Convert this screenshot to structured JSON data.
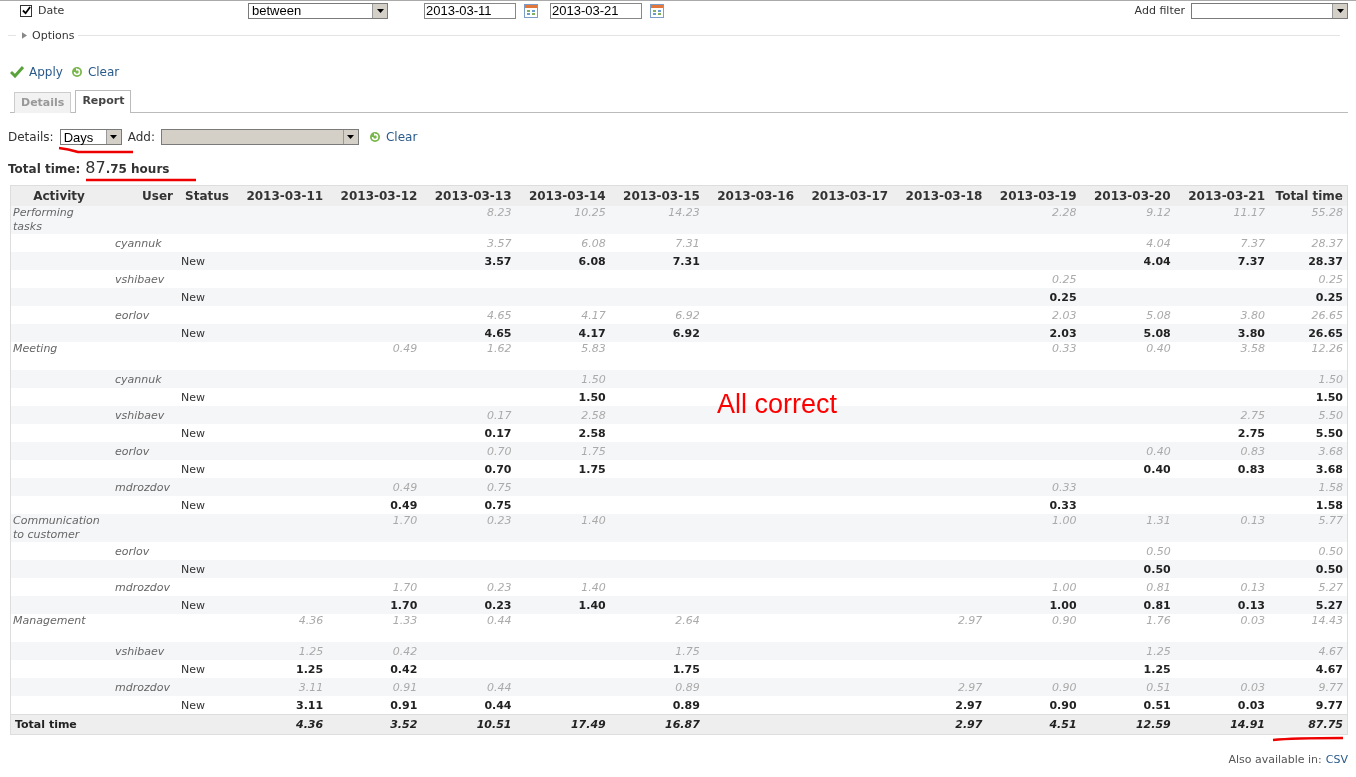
{
  "filter": {
    "checked": true,
    "label": "Date",
    "operator": "between",
    "from": "2013-03-11",
    "to": "2013-03-21",
    "add_filter_label": "Add filter"
  },
  "options": {
    "label": "Options",
    "expanded": false
  },
  "actions": {
    "apply": "Apply",
    "clear": "Clear"
  },
  "tabs": [
    {
      "label": "Details",
      "selected": false
    },
    {
      "label": "Report",
      "selected": true
    }
  ],
  "report_controls": {
    "details_label": "Details:",
    "details_value": "Days",
    "add_label": "Add:",
    "clear": "Clear"
  },
  "total": {
    "label": "Total time:",
    "hours_major": "87",
    "hours_minor": ".75 hours"
  },
  "table": {
    "columns": [
      "Activity",
      "User",
      "Status",
      "2013-03-11",
      "2013-03-12",
      "2013-03-13",
      "2013-03-14",
      "2013-03-15",
      "2013-03-16",
      "2013-03-17",
      "2013-03-18",
      "2013-03-19",
      "2013-03-20",
      "2013-03-21",
      "Total time"
    ],
    "rows": [
      {
        "kind": "activity",
        "cells": [
          {
            "kind": "label",
            "value": "Performing tasks"
          },
          {
            "kind": "empty"
          },
          {
            "kind": "empty"
          },
          {
            "kind": "empty"
          },
          {
            "kind": "empty"
          },
          {
            "kind": "hours",
            "value": "8.23"
          },
          {
            "kind": "hours",
            "value": "10.25"
          },
          {
            "kind": "hours",
            "value": "14.23"
          },
          {
            "kind": "empty"
          },
          {
            "kind": "empty"
          },
          {
            "kind": "empty"
          },
          {
            "kind": "hours",
            "value": "2.28"
          },
          {
            "kind": "hours",
            "value": "9.12"
          },
          {
            "kind": "hours",
            "value": "11.17"
          },
          {
            "kind": "total",
            "value": "55.28"
          }
        ]
      },
      {
        "kind": "user",
        "cells": [
          {
            "kind": "empty"
          },
          {
            "kind": "label",
            "value": "cyannuk"
          },
          {
            "kind": "empty"
          },
          {
            "kind": "empty"
          },
          {
            "kind": "empty"
          },
          {
            "kind": "hours",
            "value": "3.57"
          },
          {
            "kind": "hours",
            "value": "6.08"
          },
          {
            "kind": "hours",
            "value": "7.31"
          },
          {
            "kind": "empty"
          },
          {
            "kind": "empty"
          },
          {
            "kind": "empty"
          },
          {
            "kind": "empty"
          },
          {
            "kind": "hours",
            "value": "4.04"
          },
          {
            "kind": "hours",
            "value": "7.37"
          },
          {
            "kind": "total",
            "value": "28.37"
          }
        ]
      },
      {
        "kind": "status",
        "cells": [
          {
            "kind": "empty"
          },
          {
            "kind": "empty"
          },
          {
            "kind": "label",
            "value": "New"
          },
          {
            "kind": "empty"
          },
          {
            "kind": "empty"
          },
          {
            "kind": "hours",
            "value": "3.57"
          },
          {
            "kind": "hours",
            "value": "6.08"
          },
          {
            "kind": "hours",
            "value": "7.31"
          },
          {
            "kind": "empty"
          },
          {
            "kind": "empty"
          },
          {
            "kind": "empty"
          },
          {
            "kind": "empty"
          },
          {
            "kind": "hours",
            "value": "4.04"
          },
          {
            "kind": "hours",
            "value": "7.37"
          },
          {
            "kind": "total",
            "value": "28.37"
          }
        ]
      },
      {
        "kind": "user",
        "cells": [
          {
            "kind": "empty"
          },
          {
            "kind": "label",
            "value": "vshibaev"
          },
          {
            "kind": "empty"
          },
          {
            "kind": "empty"
          },
          {
            "kind": "empty"
          },
          {
            "kind": "empty"
          },
          {
            "kind": "empty"
          },
          {
            "kind": "empty"
          },
          {
            "kind": "empty"
          },
          {
            "kind": "empty"
          },
          {
            "kind": "empty"
          },
          {
            "kind": "hours",
            "value": "0.25"
          },
          {
            "kind": "empty"
          },
          {
            "kind": "empty"
          },
          {
            "kind": "total",
            "value": "0.25"
          }
        ]
      },
      {
        "kind": "status",
        "cells": [
          {
            "kind": "empty"
          },
          {
            "kind": "empty"
          },
          {
            "kind": "label",
            "value": "New"
          },
          {
            "kind": "empty"
          },
          {
            "kind": "empty"
          },
          {
            "kind": "empty"
          },
          {
            "kind": "empty"
          },
          {
            "kind": "empty"
          },
          {
            "kind": "empty"
          },
          {
            "kind": "empty"
          },
          {
            "kind": "empty"
          },
          {
            "kind": "hours",
            "value": "0.25"
          },
          {
            "kind": "empty"
          },
          {
            "kind": "empty"
          },
          {
            "kind": "total",
            "value": "0.25"
          }
        ]
      },
      {
        "kind": "user",
        "cells": [
          {
            "kind": "empty"
          },
          {
            "kind": "label",
            "value": "eorlov"
          },
          {
            "kind": "empty"
          },
          {
            "kind": "empty"
          },
          {
            "kind": "empty"
          },
          {
            "kind": "hours",
            "value": "4.65"
          },
          {
            "kind": "hours",
            "value": "4.17"
          },
          {
            "kind": "hours",
            "value": "6.92"
          },
          {
            "kind": "empty"
          },
          {
            "kind": "empty"
          },
          {
            "kind": "empty"
          },
          {
            "kind": "hours",
            "value": "2.03"
          },
          {
            "kind": "hours",
            "value": "5.08"
          },
          {
            "kind": "hours",
            "value": "3.80"
          },
          {
            "kind": "total",
            "value": "26.65"
          }
        ]
      },
      {
        "kind": "status",
        "cells": [
          {
            "kind": "empty"
          },
          {
            "kind": "empty"
          },
          {
            "kind": "label",
            "value": "New"
          },
          {
            "kind": "empty"
          },
          {
            "kind": "empty"
          },
          {
            "kind": "hours",
            "value": "4.65"
          },
          {
            "kind": "hours",
            "value": "4.17"
          },
          {
            "kind": "hours",
            "value": "6.92"
          },
          {
            "kind": "empty"
          },
          {
            "kind": "empty"
          },
          {
            "kind": "empty"
          },
          {
            "kind": "hours",
            "value": "2.03"
          },
          {
            "kind": "hours",
            "value": "5.08"
          },
          {
            "kind": "hours",
            "value": "3.80"
          },
          {
            "kind": "total",
            "value": "26.65"
          }
        ]
      },
      {
        "kind": "activity",
        "cells": [
          {
            "kind": "label",
            "value": "Meeting"
          },
          {
            "kind": "empty"
          },
          {
            "kind": "empty"
          },
          {
            "kind": "empty"
          },
          {
            "kind": "hours",
            "value": "0.49"
          },
          {
            "kind": "hours",
            "value": "1.62"
          },
          {
            "kind": "hours",
            "value": "5.83"
          },
          {
            "kind": "empty"
          },
          {
            "kind": "empty"
          },
          {
            "kind": "empty"
          },
          {
            "kind": "empty"
          },
          {
            "kind": "hours",
            "value": "0.33"
          },
          {
            "kind": "hours",
            "value": "0.40"
          },
          {
            "kind": "hours",
            "value": "3.58"
          },
          {
            "kind": "total",
            "value": "12.26"
          }
        ]
      },
      {
        "kind": "user",
        "cells": [
          {
            "kind": "empty"
          },
          {
            "kind": "label",
            "value": "cyannuk"
          },
          {
            "kind": "empty"
          },
          {
            "kind": "empty"
          },
          {
            "kind": "empty"
          },
          {
            "kind": "empty"
          },
          {
            "kind": "hours",
            "value": "1.50"
          },
          {
            "kind": "empty"
          },
          {
            "kind": "empty"
          },
          {
            "kind": "empty"
          },
          {
            "kind": "empty"
          },
          {
            "kind": "empty"
          },
          {
            "kind": "empty"
          },
          {
            "kind": "empty"
          },
          {
            "kind": "total",
            "value": "1.50"
          }
        ]
      },
      {
        "kind": "status",
        "cells": [
          {
            "kind": "empty"
          },
          {
            "kind": "empty"
          },
          {
            "kind": "label",
            "value": "New"
          },
          {
            "kind": "empty"
          },
          {
            "kind": "empty"
          },
          {
            "kind": "empty"
          },
          {
            "kind": "hours",
            "value": "1.50"
          },
          {
            "kind": "empty"
          },
          {
            "kind": "empty"
          },
          {
            "kind": "empty"
          },
          {
            "kind": "empty"
          },
          {
            "kind": "empty"
          },
          {
            "kind": "empty"
          },
          {
            "kind": "empty"
          },
          {
            "kind": "total",
            "value": "1.50"
          }
        ]
      },
      {
        "kind": "user",
        "cells": [
          {
            "kind": "empty"
          },
          {
            "kind": "label",
            "value": "vshibaev"
          },
          {
            "kind": "empty"
          },
          {
            "kind": "empty"
          },
          {
            "kind": "empty"
          },
          {
            "kind": "hours",
            "value": "0.17"
          },
          {
            "kind": "hours",
            "value": "2.58"
          },
          {
            "kind": "empty"
          },
          {
            "kind": "empty"
          },
          {
            "kind": "empty"
          },
          {
            "kind": "empty"
          },
          {
            "kind": "empty"
          },
          {
            "kind": "empty"
          },
          {
            "kind": "hours",
            "value": "2.75"
          },
          {
            "kind": "total",
            "value": "5.50"
          }
        ]
      },
      {
        "kind": "status",
        "cells": [
          {
            "kind": "empty"
          },
          {
            "kind": "empty"
          },
          {
            "kind": "label",
            "value": "New"
          },
          {
            "kind": "empty"
          },
          {
            "kind": "empty"
          },
          {
            "kind": "hours",
            "value": "0.17"
          },
          {
            "kind": "hours",
            "value": "2.58"
          },
          {
            "kind": "empty"
          },
          {
            "kind": "empty"
          },
          {
            "kind": "empty"
          },
          {
            "kind": "empty"
          },
          {
            "kind": "empty"
          },
          {
            "kind": "empty"
          },
          {
            "kind": "hours",
            "value": "2.75"
          },
          {
            "kind": "total",
            "value": "5.50"
          }
        ]
      },
      {
        "kind": "user",
        "cells": [
          {
            "kind": "empty"
          },
          {
            "kind": "label",
            "value": "eorlov"
          },
          {
            "kind": "empty"
          },
          {
            "kind": "empty"
          },
          {
            "kind": "empty"
          },
          {
            "kind": "hours",
            "value": "0.70"
          },
          {
            "kind": "hours",
            "value": "1.75"
          },
          {
            "kind": "empty"
          },
          {
            "kind": "empty"
          },
          {
            "kind": "empty"
          },
          {
            "kind": "empty"
          },
          {
            "kind": "empty"
          },
          {
            "kind": "hours",
            "value": "0.40"
          },
          {
            "kind": "hours",
            "value": "0.83"
          },
          {
            "kind": "total",
            "value": "3.68"
          }
        ]
      },
      {
        "kind": "status",
        "cells": [
          {
            "kind": "empty"
          },
          {
            "kind": "empty"
          },
          {
            "kind": "label",
            "value": "New"
          },
          {
            "kind": "empty"
          },
          {
            "kind": "empty"
          },
          {
            "kind": "hours",
            "value": "0.70"
          },
          {
            "kind": "hours",
            "value": "1.75"
          },
          {
            "kind": "empty"
          },
          {
            "kind": "empty"
          },
          {
            "kind": "empty"
          },
          {
            "kind": "empty"
          },
          {
            "kind": "empty"
          },
          {
            "kind": "hours",
            "value": "0.40"
          },
          {
            "kind": "hours",
            "value": "0.83"
          },
          {
            "kind": "total",
            "value": "3.68"
          }
        ]
      },
      {
        "kind": "user",
        "cells": [
          {
            "kind": "empty"
          },
          {
            "kind": "label",
            "value": "mdrozdov"
          },
          {
            "kind": "empty"
          },
          {
            "kind": "empty"
          },
          {
            "kind": "hours",
            "value": "0.49"
          },
          {
            "kind": "hours",
            "value": "0.75"
          },
          {
            "kind": "empty"
          },
          {
            "kind": "empty"
          },
          {
            "kind": "empty"
          },
          {
            "kind": "empty"
          },
          {
            "kind": "empty"
          },
          {
            "kind": "hours",
            "value": "0.33"
          },
          {
            "kind": "empty"
          },
          {
            "kind": "empty"
          },
          {
            "kind": "total",
            "value": "1.58"
          }
        ]
      },
      {
        "kind": "status",
        "cells": [
          {
            "kind": "empty"
          },
          {
            "kind": "empty"
          },
          {
            "kind": "label",
            "value": "New"
          },
          {
            "kind": "empty"
          },
          {
            "kind": "hours",
            "value": "0.49"
          },
          {
            "kind": "hours",
            "value": "0.75"
          },
          {
            "kind": "empty"
          },
          {
            "kind": "empty"
          },
          {
            "kind": "empty"
          },
          {
            "kind": "empty"
          },
          {
            "kind": "empty"
          },
          {
            "kind": "hours",
            "value": "0.33"
          },
          {
            "kind": "empty"
          },
          {
            "kind": "empty"
          },
          {
            "kind": "total",
            "value": "1.58"
          }
        ]
      },
      {
        "kind": "activity",
        "cells": [
          {
            "kind": "label",
            "value": "Communication to customer"
          },
          {
            "kind": "empty"
          },
          {
            "kind": "empty"
          },
          {
            "kind": "empty"
          },
          {
            "kind": "hours",
            "value": "1.70"
          },
          {
            "kind": "hours",
            "value": "0.23"
          },
          {
            "kind": "hours",
            "value": "1.40"
          },
          {
            "kind": "empty"
          },
          {
            "kind": "empty"
          },
          {
            "kind": "empty"
          },
          {
            "kind": "empty"
          },
          {
            "kind": "hours",
            "value": "1.00"
          },
          {
            "kind": "hours",
            "value": "1.31"
          },
          {
            "kind": "hours",
            "value": "0.13"
          },
          {
            "kind": "total",
            "value": "5.77"
          }
        ]
      },
      {
        "kind": "user",
        "cells": [
          {
            "kind": "empty"
          },
          {
            "kind": "label",
            "value": "eorlov"
          },
          {
            "kind": "empty"
          },
          {
            "kind": "empty"
          },
          {
            "kind": "empty"
          },
          {
            "kind": "empty"
          },
          {
            "kind": "empty"
          },
          {
            "kind": "empty"
          },
          {
            "kind": "empty"
          },
          {
            "kind": "empty"
          },
          {
            "kind": "empty"
          },
          {
            "kind": "empty"
          },
          {
            "kind": "hours",
            "value": "0.50"
          },
          {
            "kind": "empty"
          },
          {
            "kind": "total",
            "value": "0.50"
          }
        ]
      },
      {
        "kind": "status",
        "cells": [
          {
            "kind": "empty"
          },
          {
            "kind": "empty"
          },
          {
            "kind": "label",
            "value": "New"
          },
          {
            "kind": "empty"
          },
          {
            "kind": "empty"
          },
          {
            "kind": "empty"
          },
          {
            "kind": "empty"
          },
          {
            "kind": "empty"
          },
          {
            "kind": "empty"
          },
          {
            "kind": "empty"
          },
          {
            "kind": "empty"
          },
          {
            "kind": "empty"
          },
          {
            "kind": "hours",
            "value": "0.50"
          },
          {
            "kind": "empty"
          },
          {
            "kind": "total",
            "value": "0.50"
          }
        ]
      },
      {
        "kind": "user",
        "cells": [
          {
            "kind": "empty"
          },
          {
            "kind": "label",
            "value": "mdrozdov"
          },
          {
            "kind": "empty"
          },
          {
            "kind": "empty"
          },
          {
            "kind": "hours",
            "value": "1.70"
          },
          {
            "kind": "hours",
            "value": "0.23"
          },
          {
            "kind": "hours",
            "value": "1.40"
          },
          {
            "kind": "empty"
          },
          {
            "kind": "empty"
          },
          {
            "kind": "empty"
          },
          {
            "kind": "empty"
          },
          {
            "kind": "hours",
            "value": "1.00"
          },
          {
            "kind": "hours",
            "value": "0.81"
          },
          {
            "kind": "hours",
            "value": "0.13"
          },
          {
            "kind": "total",
            "value": "5.27"
          }
        ]
      },
      {
        "kind": "status",
        "cells": [
          {
            "kind": "empty"
          },
          {
            "kind": "empty"
          },
          {
            "kind": "label",
            "value": "New"
          },
          {
            "kind": "empty"
          },
          {
            "kind": "hours",
            "value": "1.70"
          },
          {
            "kind": "hours",
            "value": "0.23"
          },
          {
            "kind": "hours",
            "value": "1.40"
          },
          {
            "kind": "empty"
          },
          {
            "kind": "empty"
          },
          {
            "kind": "empty"
          },
          {
            "kind": "empty"
          },
          {
            "kind": "hours",
            "value": "1.00"
          },
          {
            "kind": "hours",
            "value": "0.81"
          },
          {
            "kind": "hours",
            "value": "0.13"
          },
          {
            "kind": "total",
            "value": "5.27"
          }
        ]
      },
      {
        "kind": "activity",
        "cells": [
          {
            "kind": "label",
            "value": "Management"
          },
          {
            "kind": "empty"
          },
          {
            "kind": "empty"
          },
          {
            "kind": "hours",
            "value": "4.36"
          },
          {
            "kind": "hours",
            "value": "1.33"
          },
          {
            "kind": "hours",
            "value": "0.44"
          },
          {
            "kind": "empty"
          },
          {
            "kind": "hours",
            "value": "2.64"
          },
          {
            "kind": "empty"
          },
          {
            "kind": "empty"
          },
          {
            "kind": "hours",
            "value": "2.97"
          },
          {
            "kind": "hours",
            "value": "0.90"
          },
          {
            "kind": "hours",
            "value": "1.76"
          },
          {
            "kind": "hours",
            "value": "0.03"
          },
          {
            "kind": "total",
            "value": "14.43"
          }
        ]
      },
      {
        "kind": "user",
        "cells": [
          {
            "kind": "empty"
          },
          {
            "kind": "label",
            "value": "vshibaev"
          },
          {
            "kind": "empty"
          },
          {
            "kind": "hours",
            "value": "1.25"
          },
          {
            "kind": "hours",
            "value": "0.42"
          },
          {
            "kind": "empty"
          },
          {
            "kind": "empty"
          },
          {
            "kind": "hours",
            "value": "1.75"
          },
          {
            "kind": "empty"
          },
          {
            "kind": "empty"
          },
          {
            "kind": "empty"
          },
          {
            "kind": "empty"
          },
          {
            "kind": "hours",
            "value": "1.25"
          },
          {
            "kind": "empty"
          },
          {
            "kind": "total",
            "value": "4.67"
          }
        ]
      },
      {
        "kind": "status",
        "cells": [
          {
            "kind": "empty"
          },
          {
            "kind": "empty"
          },
          {
            "kind": "label",
            "value": "New"
          },
          {
            "kind": "hours",
            "value": "1.25"
          },
          {
            "kind": "hours",
            "value": "0.42"
          },
          {
            "kind": "empty"
          },
          {
            "kind": "empty"
          },
          {
            "kind": "hours",
            "value": "1.75"
          },
          {
            "kind": "empty"
          },
          {
            "kind": "empty"
          },
          {
            "kind": "empty"
          },
          {
            "kind": "empty"
          },
          {
            "kind": "hours",
            "value": "1.25"
          },
          {
            "kind": "empty"
          },
          {
            "kind": "total",
            "value": "4.67"
          }
        ]
      },
      {
        "kind": "user",
        "cells": [
          {
            "kind": "empty"
          },
          {
            "kind": "label",
            "value": "mdrozdov"
          },
          {
            "kind": "empty"
          },
          {
            "kind": "hours",
            "value": "3.11"
          },
          {
            "kind": "hours",
            "value": "0.91"
          },
          {
            "kind": "hours",
            "value": "0.44"
          },
          {
            "kind": "empty"
          },
          {
            "kind": "hours",
            "value": "0.89"
          },
          {
            "kind": "empty"
          },
          {
            "kind": "empty"
          },
          {
            "kind": "hours",
            "value": "2.97"
          },
          {
            "kind": "hours",
            "value": "0.90"
          },
          {
            "kind": "hours",
            "value": "0.51"
          },
          {
            "kind": "hours",
            "value": "0.03"
          },
          {
            "kind": "total",
            "value": "9.77"
          }
        ]
      },
      {
        "kind": "status",
        "cells": [
          {
            "kind": "empty"
          },
          {
            "kind": "empty"
          },
          {
            "kind": "label",
            "value": "New"
          },
          {
            "kind": "hours",
            "value": "3.11"
          },
          {
            "kind": "hours",
            "value": "0.91"
          },
          {
            "kind": "hours",
            "value": "0.44"
          },
          {
            "kind": "empty"
          },
          {
            "kind": "hours",
            "value": "0.89"
          },
          {
            "kind": "empty"
          },
          {
            "kind": "empty"
          },
          {
            "kind": "hours",
            "value": "2.97"
          },
          {
            "kind": "hours",
            "value": "0.90"
          },
          {
            "kind": "hours",
            "value": "0.51"
          },
          {
            "kind": "hours",
            "value": "0.03"
          },
          {
            "kind": "total",
            "value": "9.77"
          }
        ]
      },
      {
        "kind": "totals",
        "cells": [
          {
            "kind": "label",
            "value": "Total time"
          },
          {
            "kind": "empty"
          },
          {
            "kind": "empty"
          },
          {
            "kind": "hours",
            "value": "4.36"
          },
          {
            "kind": "hours",
            "value": "3.52"
          },
          {
            "kind": "hours",
            "value": "10.51"
          },
          {
            "kind": "hours",
            "value": "17.49"
          },
          {
            "kind": "hours",
            "value": "16.87"
          },
          {
            "kind": "empty"
          },
          {
            "kind": "empty"
          },
          {
            "kind": "hours",
            "value": "2.97"
          },
          {
            "kind": "hours",
            "value": "4.51"
          },
          {
            "kind": "hours",
            "value": "12.59"
          },
          {
            "kind": "hours",
            "value": "14.91"
          },
          {
            "kind": "total",
            "value": "87.75"
          }
        ]
      }
    ]
  },
  "annotation": "All correct",
  "footer": {
    "label": "Also available in:",
    "link": "CSV"
  }
}
